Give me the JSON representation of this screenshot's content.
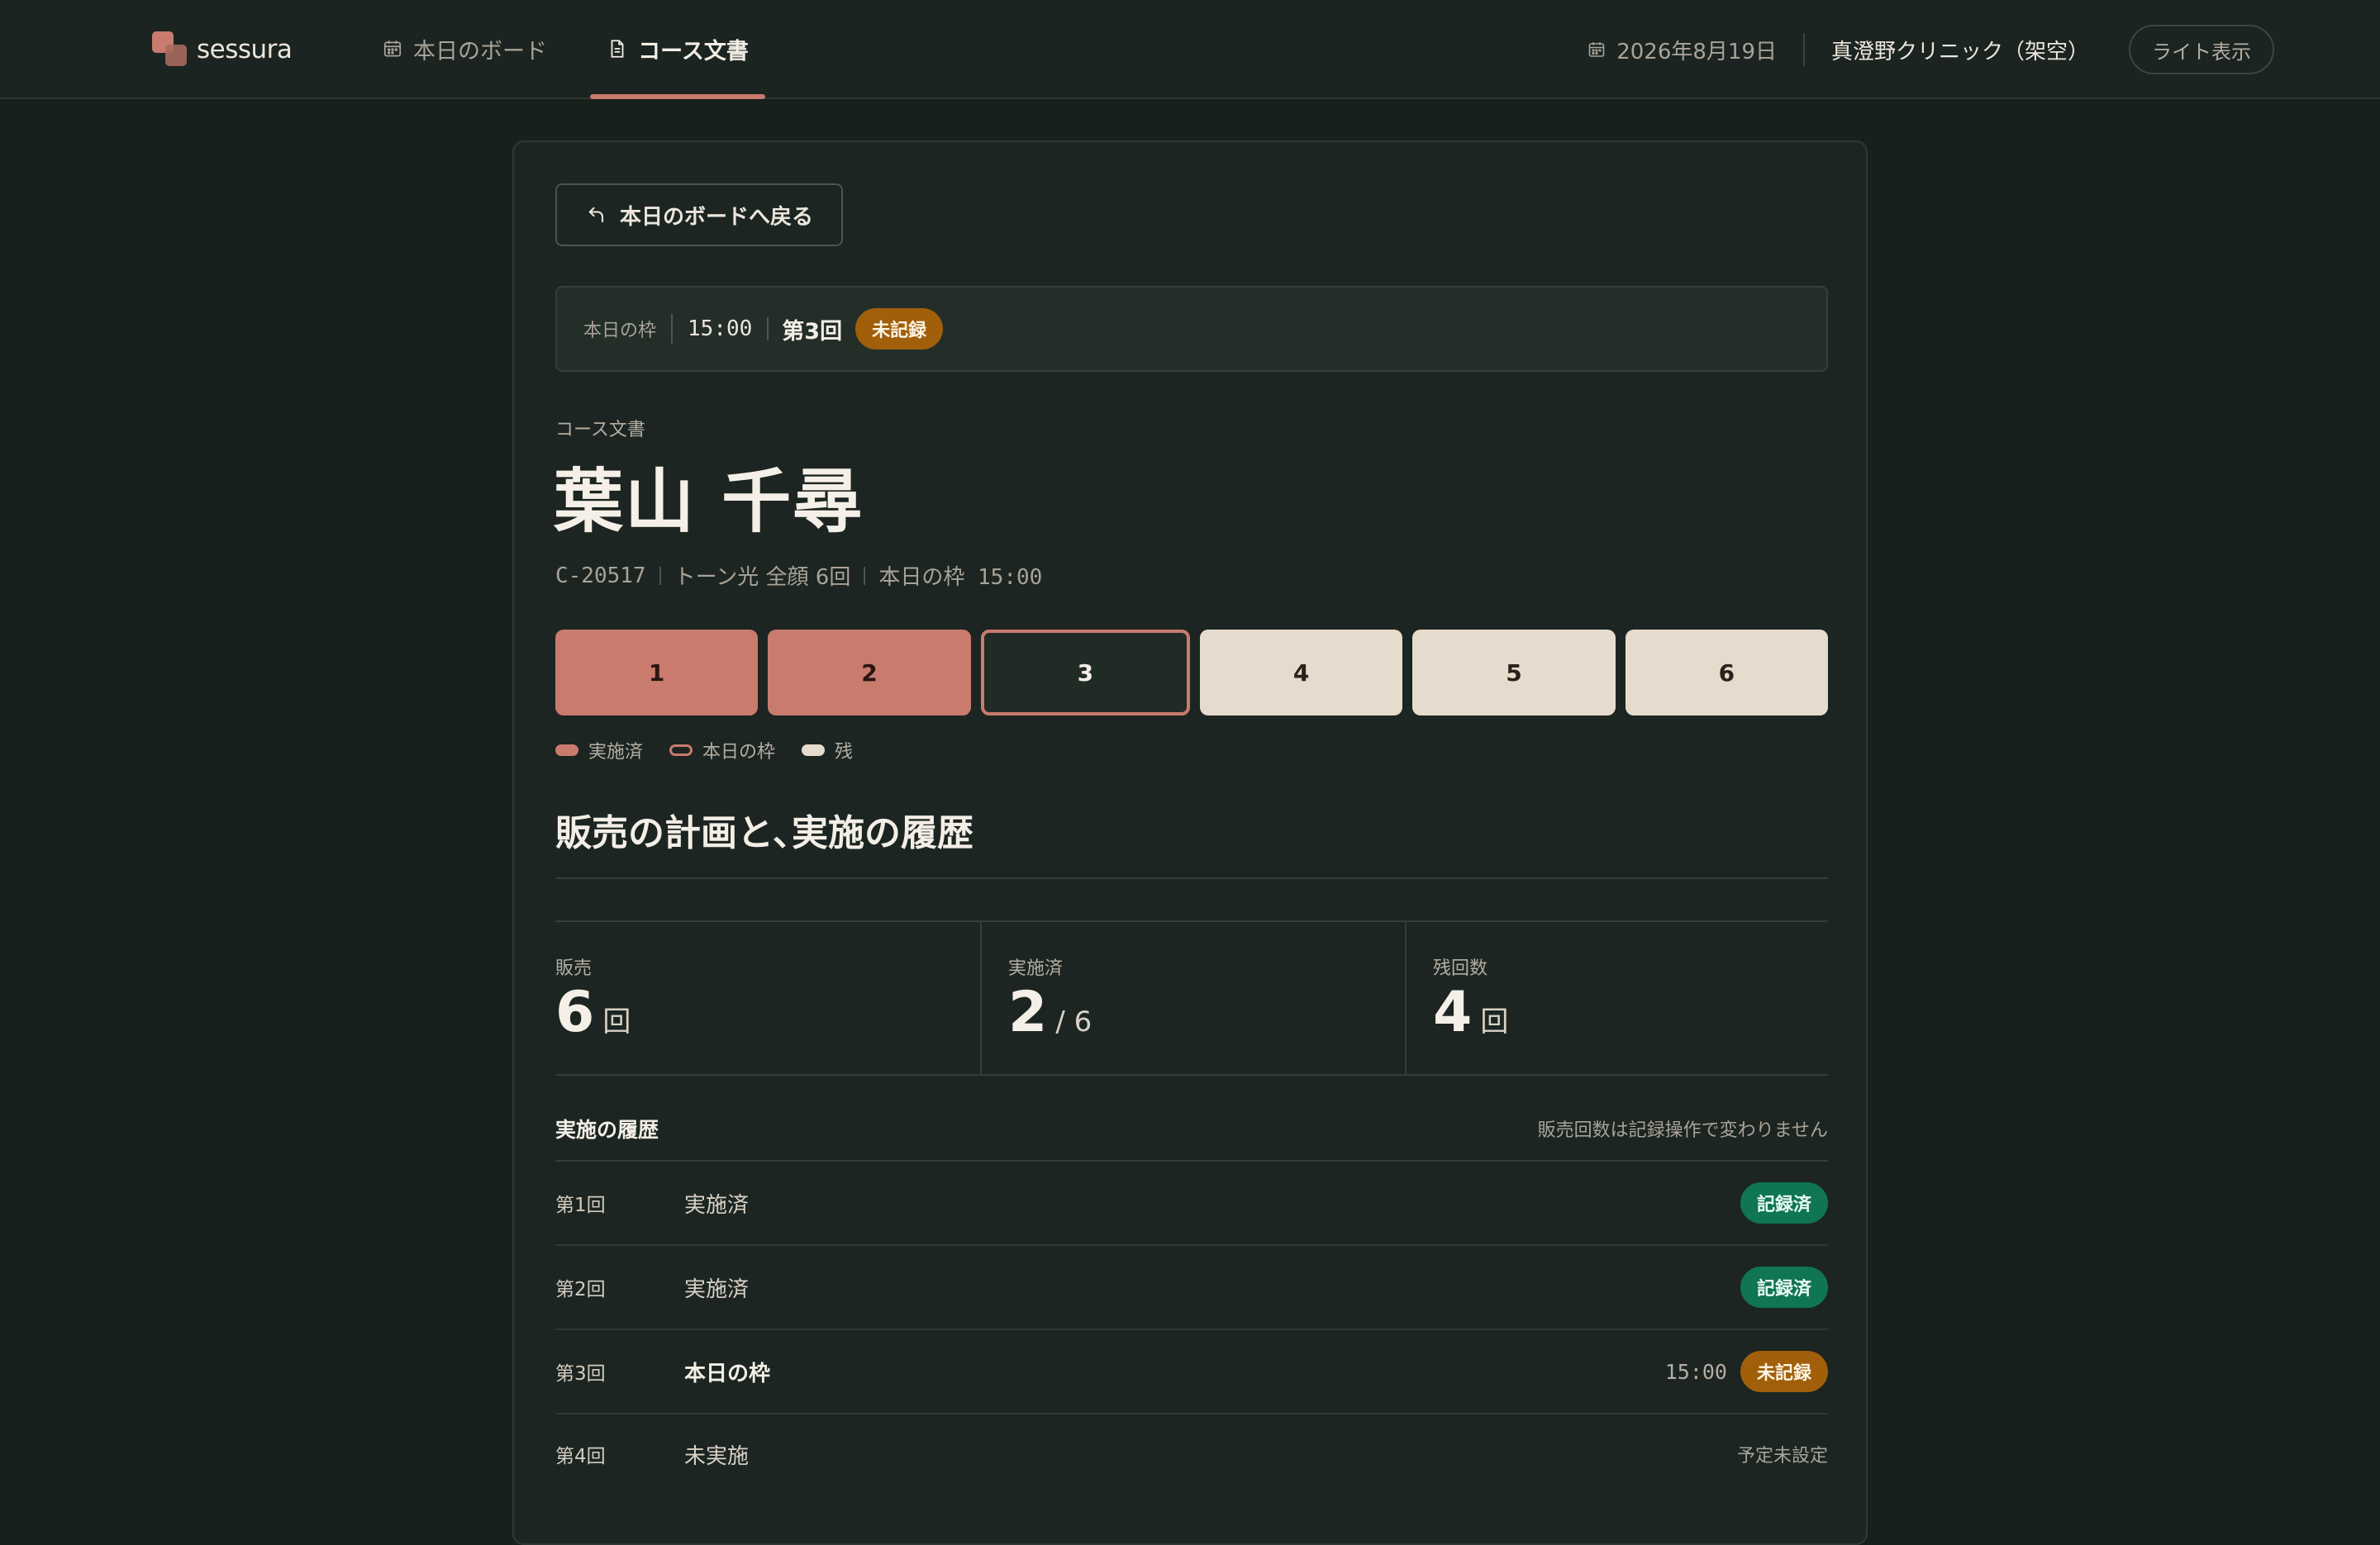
{
  "app": {
    "name": "sessura"
  },
  "nav": {
    "board_label": "本日のボード",
    "docs_label": "コース文書"
  },
  "header": {
    "date": "2026年8月19日",
    "clinic": "真澄野クリニック（架空）",
    "theme_label": "ライト表示"
  },
  "back_button": "本日のボードへ戻る",
  "slot": {
    "label": "本日の枠",
    "time": "15:00",
    "count": "第3回",
    "status": "未記録"
  },
  "doc": {
    "eyebrow": "コース文書",
    "patient_name": "葉山 千尋",
    "meta": {
      "id": "C-20517",
      "course": "トーン光 全顔 6回",
      "slot": "本日の枠 15:00"
    }
  },
  "sessions": [
    {
      "label": "1",
      "state": "done"
    },
    {
      "label": "2",
      "state": "done"
    },
    {
      "label": "3",
      "state": "today"
    },
    {
      "label": "4",
      "state": "remaining"
    },
    {
      "label": "5",
      "state": "remaining"
    },
    {
      "label": "6",
      "state": "remaining"
    }
  ],
  "legend": {
    "done": "実施済",
    "today": "本日の枠",
    "remaining": "残"
  },
  "section_title": "販売の計画と､実施の履歴",
  "stats": {
    "sold": {
      "label": "販売",
      "value": "6",
      "unit": "回"
    },
    "done": {
      "label": "実施済",
      "value": "2",
      "unit": "/ 6"
    },
    "remaining": {
      "label": "残回数",
      "value": "4",
      "unit": "回"
    }
  },
  "history": {
    "title": "実施の履歴",
    "note": "販売回数は記録操作で変わりません",
    "rows": [
      {
        "num": "第1回",
        "status": "実施済",
        "time": "",
        "badge": "記録済",
        "plain": ""
      },
      {
        "num": "第2回",
        "status": "実施済",
        "time": "",
        "badge": "記録済",
        "plain": ""
      },
      {
        "num": "第3回",
        "status": "本日の枠",
        "time": "15:00",
        "badge": "未記録",
        "plain": ""
      },
      {
        "num": "第4回",
        "status": "未実施",
        "time": "",
        "badge": "",
        "plain": "予定未設定"
      }
    ]
  },
  "colors": {
    "accent": "#c97b6e",
    "pending": "#a15f0a",
    "recorded": "#0f7553",
    "remaining": "#e6dccd",
    "background": "#18201c"
  }
}
